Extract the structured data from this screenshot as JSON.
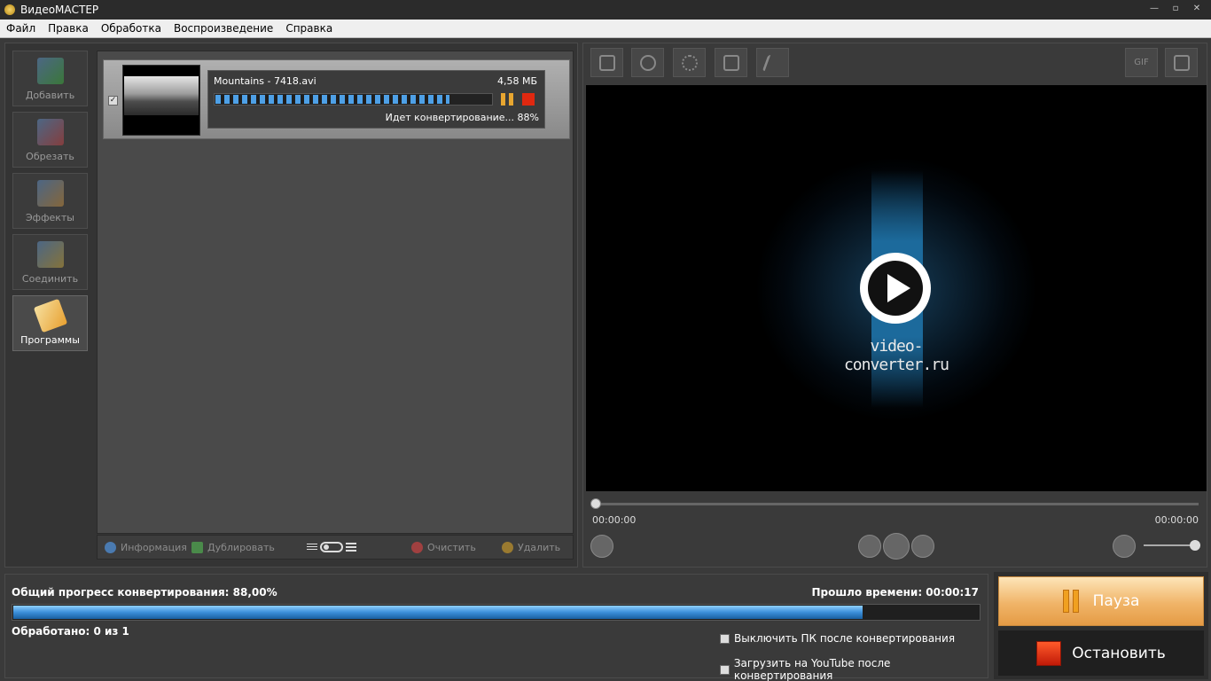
{
  "window": {
    "title": "ВидеоМАСТЕР",
    "controls": [
      "—",
      "▫",
      "✕"
    ]
  },
  "menu": [
    "Файл",
    "Правка",
    "Обработка",
    "Воспроизведение",
    "Справка"
  ],
  "sidebar": [
    {
      "label": "Добавить",
      "icon": "add-video-icon",
      "color": "#3aa838"
    },
    {
      "label": "Обрезать",
      "icon": "trim-icon",
      "color": "#5a8ac0"
    },
    {
      "label": "Эффекты",
      "icon": "effects-icon",
      "color": "#c08a3a"
    },
    {
      "label": "Соединить",
      "icon": "join-icon",
      "color": "#5a8ac0"
    },
    {
      "label": "Программы",
      "icon": "programs-icon",
      "color": "#e8c050"
    }
  ],
  "file": {
    "name": "Mountains - 7418.avi",
    "size": "4,58 МБ",
    "status": "Идет конвертирование... 88%",
    "progress_fraction": 0.85,
    "checked": "✓"
  },
  "list_toolbar": {
    "info": "Информация",
    "duplicate": "Дублировать",
    "clear": "Очистить",
    "delete": "Удалить"
  },
  "tools": [
    "crop-icon",
    "watermark-icon",
    "brightness-icon",
    "rotate-icon",
    "speed-icon"
  ],
  "gif_label": "GIF",
  "player": {
    "watermark": "video-converter.ru",
    "time_current": "00:00:00",
    "time_total": "00:00:00"
  },
  "progress": {
    "title": "Общий прогресс конвертирования: 88,00%",
    "elapsed": "Прошло времени: 00:00:17",
    "processed": "Обработано: 0 из 1",
    "fraction": 0.88,
    "opt_shutdown": "Выключить ПК после конвертирования",
    "opt_youtube": "Загрузить на YouTube после конвертирования"
  },
  "actions": {
    "pause": "Пауза",
    "stop": "Остановить"
  },
  "colors": {
    "accent_blue": "#3c8fd9",
    "pause_orange": "#f0b468",
    "stop_red": "#e02810"
  }
}
